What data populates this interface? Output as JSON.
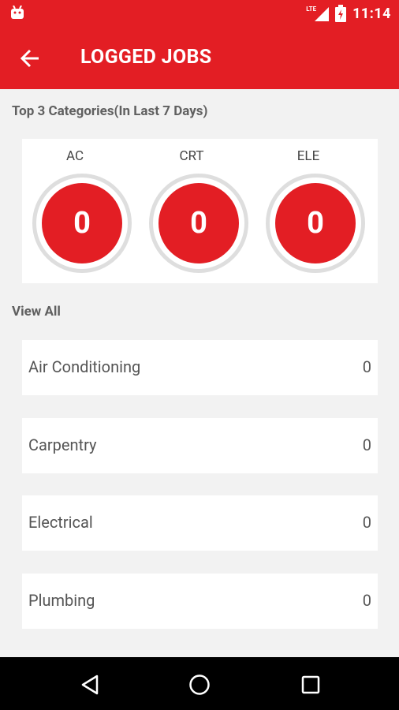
{
  "status_bar": {
    "time": "11:14",
    "network": "LTE",
    "icons": [
      "android-icon",
      "signal-icon",
      "battery-icon"
    ]
  },
  "header": {
    "title": "LOGGED JOBS",
    "back_icon": "arrow-left-icon"
  },
  "top_categories": {
    "label": "Top 3 Categories(In Last 7 Days)",
    "items": [
      {
        "code": "AC",
        "count": "0"
      },
      {
        "code": "CRT",
        "count": "0"
      },
      {
        "code": "ELE",
        "count": "0"
      }
    ]
  },
  "view_all": {
    "label": "View All",
    "items": [
      {
        "name": "Air Conditioning",
        "count": "0"
      },
      {
        "name": "Carpentry",
        "count": "0"
      },
      {
        "name": "Electrical",
        "count": "0"
      },
      {
        "name": "Plumbing",
        "count": "0"
      }
    ]
  },
  "nav": {
    "icons": [
      "back-triangle-icon",
      "home-circle-icon",
      "recents-square-icon"
    ]
  },
  "colors": {
    "primary": "#e31e24",
    "background": "#f2f2f2",
    "card": "#ffffff",
    "ring": "#dedede"
  }
}
